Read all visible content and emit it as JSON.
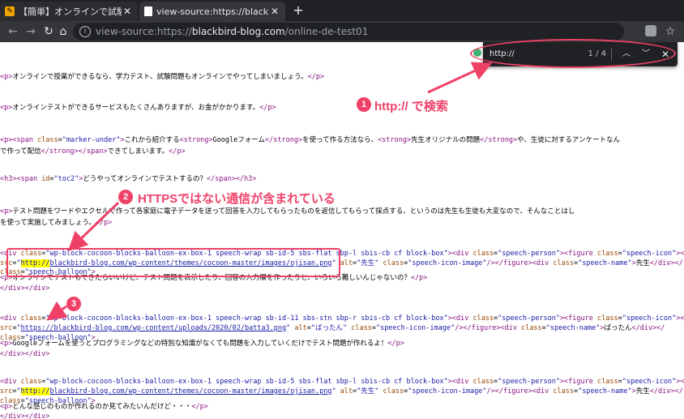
{
  "tabs": [
    {
      "title": "【簡単】オンラインで試験問題を出すっ",
      "favicon_color": "#f0a500",
      "active": false
    },
    {
      "title": "view-source:https://blackbird-blo",
      "favicon_color": "#ffffff",
      "active": true
    }
  ],
  "new_tab_label": "+",
  "tab_close_glyph": "✕",
  "address": {
    "url_pre": "view-source:https://",
    "url_host": "blackbird-blog.com",
    "url_post": "/online-de-test01"
  },
  "find_bar": {
    "query": "http://",
    "count": "1 / 4"
  },
  "annotations": [
    {
      "number": "1",
      "text": "http:// で検索"
    },
    {
      "number": "2",
      "text": "HTTPSではない通信が含まれている"
    },
    {
      "number": "3",
      "text": ""
    }
  ],
  "accent_color": "#ef4168",
  "source_lines": [
    {
      "no": "",
      "html": ""
    },
    {
      "no": "",
      "html": "<span class='tag'>&lt;p&gt;</span>オンラインで授業ができるなら、学力テスト、試験問題もオンラインでやってしまいましょう。<span class='tag'>&lt;/p&gt;</span>"
    },
    {
      "no": "",
      "html": "<span class='tag'>&lt;p&gt;</span>オンラインテストができるサービスもたくさんありますが、お金がかかります。<span class='tag'>&lt;/p&gt;</span>"
    },
    {
      "no": "",
      "html": "<span class='tag'>&lt;p&gt;&lt;span</span> <span class='attr'>class</span>=<span class='val'>\"marker-under\"</span><span class='tag'>&gt;</span>これから紹介する<span class='tag'>&lt;strong&gt;</span>Googleフォーム<span class='tag'>&lt;/strong&gt;</span>を使って作る方法なら、<span class='tag'>&lt;strong&gt;</span>先生オリジナルの問題<span class='tag'>&lt;/strong&gt;</span>や、生徒に対するアンケートなん"
    },
    {
      "no": "",
      "html": "で作って配信<span class='tag'>&lt;/strong&gt;&lt;/span&gt;</span>できてしまいます。<span class='tag'>&lt;/p&gt;</span>"
    },
    {
      "no": "",
      "html": "<span class='tag'>&lt;h3&gt;&lt;span</span> <span class='attr'>id</span>=<span class='val'>\"toc2\"</span><span class='tag'>&gt;</span>どうやってオンラインでテストするの？<span class='tag'>&lt;/span&gt;&lt;/h3&gt;</span>"
    },
    {
      "no": "",
      "html": "<span class='tag'>&lt;p&gt;</span>テスト問題をワードやエクセルで作って各家庭に電子データを送って回答を入力してもらったものを返信してもらって採点する、というのは先生も生徒も大変なので、そんなことはし"
    },
    {
      "no": "",
      "html": "を使って実施してみましょう。<span class='tag'>&lt;/p&gt;</span>"
    },
    {
      "no": "",
      "html": "<span class='tag'>&lt;div</span> <span class='attr'>class</span>=<span class='val'>\"wp-block-cocoon-blocks-balloon-ex-box-1 speech-wrap sb-id-5 sbs-flat sbp-l sbis-cb cf block-box\"</span><span class='tag'>&gt;&lt;div</span> <span class='attr'>class</span>=<span class='val'>\"speech-person\"</span><span class='tag'>&gt;&lt;figure</span> <span class='attr'>class</span>=<span class='val'>\"speech-icon\"</span><span class='tag'>&gt;&lt;i</span>"
    },
    {
      "no": "",
      "html": "<span class='attr'>src</span>=<span class='val'>\"</span><span class='hl'>http://</span><span class='lnk'>blackbird-blog.com/wp-content/themes/cocoon-master/images/ojisan.png</span><span class='val'>\"</span> <span class='attr'>alt</span>=<span class='val'>\"先生\"</span> <span class='attr'>class</span>=<span class='val'>\"speech-icon-image\"</span><span class='tag'>/&gt;&lt;/figure&gt;&lt;div</span> <span class='attr'>class</span>=<span class='val'>\"speech-name\"</span><span class='tag'>&gt;</span>先生<span class='tag'>&lt;/div&gt;&lt;/</span>"
    },
    {
      "no": "",
      "html": "<span class='attr'>class</span>=<span class='val'>\"speech-balloon\"</span><span class='tag'>&gt;</span>"
    },
    {
      "no": "",
      "html": "<span class='tag'>&lt;p&gt;</span>オンラインでテストもできたらいいけど、テスト問題を表示したり、回答の入力欄を作ったりと、いろいろ難しいんじゃないの？<span class='tag'>&lt;/p&gt;</span>"
    },
    {
      "no": "",
      "html": "<span class='tag'>&lt;/div&gt;&lt;/div&gt;</span>"
    },
    {
      "no": "",
      "html": "<span class='tag'>&lt;div</span> <span class='attr'>class</span>=<span class='val'>\"wp-block-cocoon-blocks-balloon-ex-box-1 speech-wrap sb-id-11 sbs-stn sbp-r sbis-cb cf block-box\"</span><span class='tag'>&gt;&lt;div</span> <span class='attr'>class</span>=<span class='val'>\"speech-person\"</span><span class='tag'>&gt;&lt;figure</span> <span class='attr'>class</span>=<span class='val'>\"speech-icon\"</span><span class='tag'>&gt;&lt;i</span>"
    },
    {
      "no": "",
      "html": "<span class='attr'>src</span>=<span class='val'>\"</span><span class='lnk'>https://blackbird-blog.com/wp-content/uploads/2020/02/batta3.png</span><span class='val'>\"</span> <span class='attr'>alt</span>=<span class='val'>\"ばったん\"</span> <span class='attr'>class</span>=<span class='val'>\"speech-icon-image\"</span><span class='tag'>/&gt;&lt;/figure&gt;&lt;div</span> <span class='attr'>class</span>=<span class='val'>\"speech-name\"</span><span class='tag'>&gt;</span>ばったん<span class='tag'>&lt;/div&gt;&lt;/</span>"
    },
    {
      "no": "",
      "html": "<span class='attr'>class</span>=<span class='val'>\"speech-balloon\"</span><span class='tag'>&gt;</span>"
    },
    {
      "no": "",
      "html": "<span class='tag'>&lt;p&gt;</span>Googleフォームを使うとプログラミングなどの特別な知識がなくても問題を入力していくだけでテスト問題が作れるよ！<span class='tag'>&lt;/p&gt;</span>"
    },
    {
      "no": "",
      "html": "<span class='tag'>&lt;/div&gt;&lt;/div&gt;</span>"
    },
    {
      "no": "",
      "html": "<span class='tag'>&lt;div</span> <span class='attr'>class</span>=<span class='val'>\"wp-block-cocoon-blocks-balloon-ex-box-1 speech-wrap sb-id-5 sbs-flat sbp-l sbis-cb cf block-box\"</span><span class='tag'>&gt;&lt;div</span> <span class='attr'>class</span>=<span class='val'>\"speech-person\"</span><span class='tag'>&gt;&lt;figure</span> <span class='attr'>class</span>=<span class='val'>\"speech-icon\"</span><span class='tag'>&gt;&lt;i</span>"
    },
    {
      "no": "",
      "html": "<span class='attr'>src</span>=<span class='val'>\"</span><span class='hl'>http://</span><span class='lnk'>blackbird-blog.com/wp-content/themes/cocoon-master/images/ojisan.png</span><span class='val'>\"</span> <span class='attr'>alt</span>=<span class='val'>\"先生\"</span> <span class='attr'>class</span>=<span class='val'>\"speech-icon-image\"</span><span class='tag'>/&gt;&lt;/figure&gt;&lt;div</span> <span class='attr'>class</span>=<span class='val'>\"speech-name\"</span><span class='tag'>&gt;</span>先生<span class='tag'>&lt;/div&gt;&lt;/</span>"
    },
    {
      "no": "",
      "html": "<span class='attr'>class</span>=<span class='val'>\"speech-balloon\"</span><span class='tag'>&gt;</span>"
    },
    {
      "no": "",
      "html": "<span class='tag'>&lt;p&gt;</span>どんな感じのものが作れるのか見てみたいんだけど・・・<span class='tag'>&lt;/p&gt;</span>"
    },
    {
      "no": "",
      "html": "<span class='tag'>&lt;/div&gt;&lt;/div&gt;</span>"
    }
  ]
}
